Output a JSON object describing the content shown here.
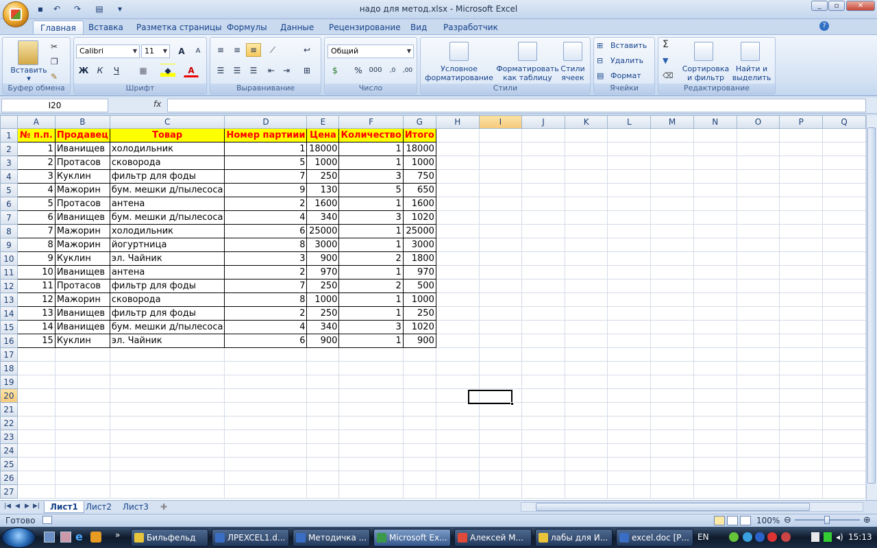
{
  "window": {
    "title": "надо для метод.xlsx - Microsoft Excel",
    "buttons": {
      "minimize": "_",
      "restore": "▫",
      "close": "✕"
    }
  },
  "tabs": [
    "Главная",
    "Вставка",
    "Разметка страницы",
    "Формулы",
    "Данные",
    "Рецензирование",
    "Вид",
    "Разработчик"
  ],
  "ribbon": {
    "clipboard": {
      "paste": "Вставить",
      "label": "Буфер обмена"
    },
    "font": {
      "name": "Calibri",
      "size": "11",
      "bold": "Ж",
      "italic": "К",
      "underline": "Ч",
      "grow": "A",
      "shrink": "A",
      "font_color": "A",
      "label": "Шрифт"
    },
    "align": {
      "label": "Выравнивание"
    },
    "number": {
      "format": "Общий",
      "percent": "%",
      "thousands": "000",
      "label": "Число"
    },
    "styles": {
      "cond1": "Условное",
      "cond2": "форматирование",
      "table1": "Форматировать",
      "table2": "как таблицу",
      "cell1": "Стили",
      "cell2": "ячеек",
      "label": "Стили"
    },
    "cells": {
      "insert": "Вставить",
      "delete": "Удалить",
      "format": "Формат",
      "label": "Ячейки"
    },
    "editing": {
      "sigma": "Σ",
      "sort1": "Сортировка",
      "sort2": "и фильтр",
      "find1": "Найти и",
      "find2": "выделить",
      "label": "Редактирование"
    }
  },
  "formula_bar": {
    "name_box": "I20",
    "fx": "fx",
    "value": ""
  },
  "columns": [
    "A",
    "B",
    "C",
    "D",
    "E",
    "F",
    "G",
    "H",
    "I",
    "J",
    "K",
    "L",
    "M",
    "N",
    "O",
    "P",
    "Q"
  ],
  "selected_cell": {
    "column": "I",
    "row": 20
  },
  "table_headers": [
    "№ п.п.",
    "Продавец",
    "Товар",
    "Номер партиии",
    "Цена",
    "Количество",
    "Итого"
  ],
  "table_rows": [
    [
      "1",
      "Иванищев",
      "холодильник",
      "1",
      "18000",
      "1",
      "18000"
    ],
    [
      "2",
      "Протасов",
      "сковорода",
      "5",
      "1000",
      "1",
      "1000"
    ],
    [
      "3",
      "Куклин",
      "фильтр для фоды",
      "7",
      "250",
      "3",
      "750"
    ],
    [
      "4",
      "Мажорин",
      "бум. мешки д/пылесоса",
      "9",
      "130",
      "5",
      "650"
    ],
    [
      "5",
      "Протасов",
      "антена",
      "2",
      "1600",
      "1",
      "1600"
    ],
    [
      "6",
      "Иванищев",
      "бум. мешки д/пылесоса",
      "4",
      "340",
      "3",
      "1020"
    ],
    [
      "7",
      "Мажорин",
      "холодильник",
      "6",
      "25000",
      "1",
      "25000"
    ],
    [
      "8",
      "Мажорин",
      "йогуртница",
      "8",
      "3000",
      "1",
      "3000"
    ],
    [
      "9",
      "Куклин",
      "эл. Чайник",
      "3",
      "900",
      "2",
      "1800"
    ],
    [
      "10",
      "Иванищев",
      "антена",
      "2",
      "970",
      "1",
      "970"
    ],
    [
      "11",
      "Протасов",
      "фильтр для фоды",
      "7",
      "250",
      "2",
      "500"
    ],
    [
      "12",
      "Мажорин",
      "сковорода",
      "8",
      "1000",
      "1",
      "1000"
    ],
    [
      "13",
      "Иванищев",
      "фильтр для фоды",
      "2",
      "250",
      "1",
      "250"
    ],
    [
      "14",
      "Иванищев",
      "бум. мешки д/пылесоса",
      "4",
      "340",
      "3",
      "1020"
    ],
    [
      "15",
      "Куклин",
      "эл. Чайник",
      "6",
      "900",
      "1",
      "900"
    ]
  ],
  "row_count": 27,
  "sheets": [
    "Лист1",
    "Лист2",
    "Лист3"
  ],
  "active_sheet": "Лист1",
  "status": {
    "ready": "Готово",
    "zoom": "100%"
  },
  "taskbar": {
    "items": [
      "Бильфельд",
      "ЛРEXCEL1.d...",
      "Методичка ...",
      "Microsoft Ex...",
      "Алексей М...",
      "лабы для И...",
      "excel.doc [Р..."
    ],
    "active_index": 3,
    "lang": "EN",
    "clock": "15:13"
  },
  "colors": {
    "header_fill": "#ffff00",
    "header_text": "#ff0000",
    "selected_header": "#f7c87a"
  }
}
